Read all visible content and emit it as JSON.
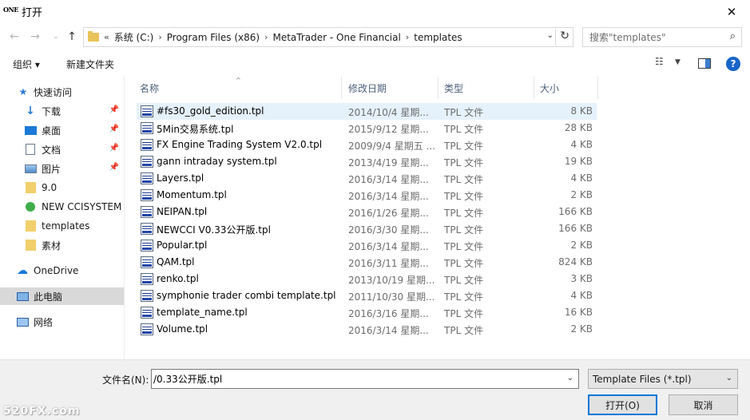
{
  "window": {
    "logo": "ONE",
    "title": "打开"
  },
  "nav": {
    "breadcrumbs": [
      "系统 (C:)",
      "Program Files (x86)",
      "MetaTrader - One Financial",
      "templates"
    ],
    "search_placeholder": "搜索\"templates\""
  },
  "toolbar": {
    "organize": "组织 ▾",
    "new_folder": "新建文件夹"
  },
  "sidebar": {
    "quick_access": "快速访问",
    "items": [
      "下载",
      "桌面",
      "文档",
      "图片",
      "9.0",
      "NEW CCISYSTEM",
      "templates",
      "素材"
    ],
    "onedrive": "OneDrive",
    "this_pc": "此电脑",
    "network": "网络"
  },
  "columns": {
    "name": "名称",
    "date": "修改日期",
    "type": "类型",
    "size": "大小"
  },
  "files": [
    {
      "name": "#fs30_gold_edition.tpl",
      "date": "2014/10/4 星期...",
      "type": "TPL 文件",
      "size": "8 KB"
    },
    {
      "name": "5Min交易系统.tpl",
      "date": "2015/9/12 星期...",
      "type": "TPL 文件",
      "size": "28 KB"
    },
    {
      "name": "FX Engine Trading System V2.0.tpl",
      "date": "2009/9/4 星期五 ...",
      "type": "TPL 文件",
      "size": "4 KB"
    },
    {
      "name": "gann intraday system.tpl",
      "date": "2013/4/19 星期...",
      "type": "TPL 文件",
      "size": "19 KB"
    },
    {
      "name": "Layers.tpl",
      "date": "2016/3/14 星期...",
      "type": "TPL 文件",
      "size": "4 KB"
    },
    {
      "name": "Momentum.tpl",
      "date": "2016/3/14 星期...",
      "type": "TPL 文件",
      "size": "2 KB"
    },
    {
      "name": "NEIPAN.tpl",
      "date": "2016/1/26 星期...",
      "type": "TPL 文件",
      "size": "166 KB"
    },
    {
      "name": "NEWCCI V0.33公开版.tpl",
      "date": "2016/3/30 星期...",
      "type": "TPL 文件",
      "size": "166 KB"
    },
    {
      "name": "Popular.tpl",
      "date": "2016/3/14 星期...",
      "type": "TPL 文件",
      "size": "2 KB"
    },
    {
      "name": "QAM.tpl",
      "date": "2016/3/11 星期...",
      "type": "TPL 文件",
      "size": "824 KB"
    },
    {
      "name": "renko.tpl",
      "date": "2013/10/19 星期...",
      "type": "TPL 文件",
      "size": "3 KB"
    },
    {
      "name": "symphonie trader combi template.tpl",
      "date": "2011/10/30 星期...",
      "type": "TPL 文件",
      "size": "4 KB"
    },
    {
      "name": "template_name.tpl",
      "date": "2016/3/16 星期...",
      "type": "TPL 文件",
      "size": "16 KB"
    },
    {
      "name": "Volume.tpl",
      "date": "2016/3/14 星期...",
      "type": "TPL 文件",
      "size": "2 KB"
    }
  ],
  "bottom": {
    "filename_label": "文件名(N):",
    "filename_value": "/0.33公开版.tpl",
    "filter": "Template Files (*.tpl)",
    "open": "打开(O)",
    "cancel": "取消"
  },
  "watermark": "520FX.com"
}
